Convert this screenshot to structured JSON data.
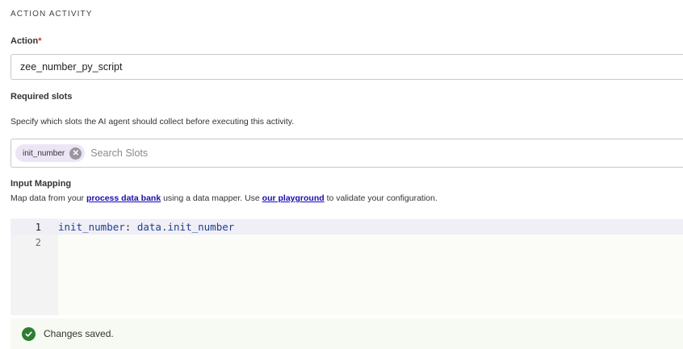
{
  "section": {
    "title": "ACTION ACTIVITY"
  },
  "action": {
    "label": "Action",
    "required_mark": "*",
    "value": "zee_number_py_script"
  },
  "required_slots": {
    "label": "Required slots",
    "helper": "Specify which slots the AI agent should collect before executing this activity.",
    "chips": [
      "init_number"
    ],
    "search_placeholder": "Search Slots"
  },
  "input_mapping": {
    "label": "Input Mapping",
    "helper_prefix": "Map data from your ",
    "helper_link1": "process data bank",
    "helper_middle": " using a data mapper. Use ",
    "helper_link2": "our playground",
    "helper_suffix": " to validate your configuration.",
    "lines": [
      {
        "no": "1",
        "key": "init_number",
        "sep": ": ",
        "val": "data.init_number"
      },
      {
        "no": "2",
        "key": "",
        "sep": "",
        "val": ""
      }
    ]
  },
  "status": {
    "text": "Changes saved.",
    "icon": "check-circle-icon",
    "color": "#2e7d32"
  }
}
